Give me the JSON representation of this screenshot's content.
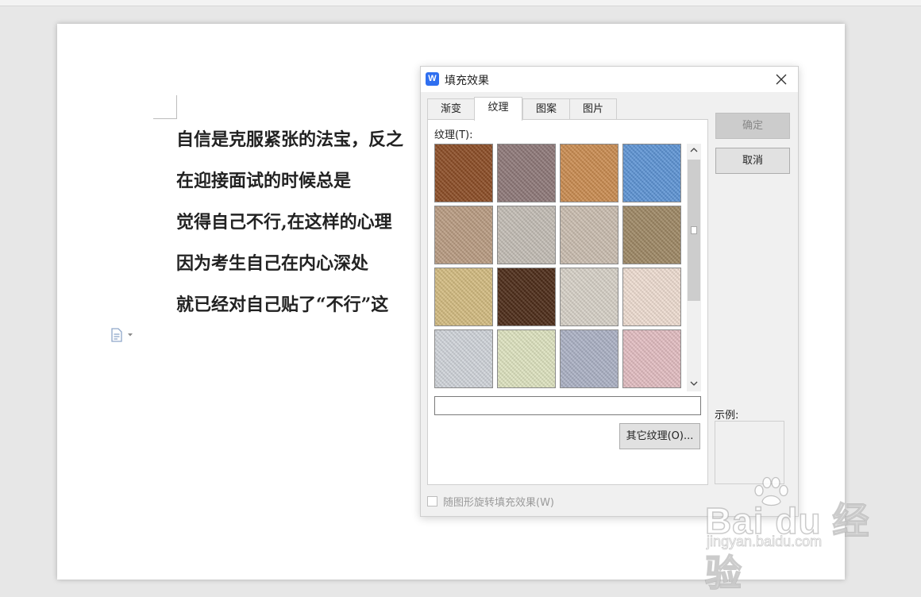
{
  "document": {
    "lines": [
      "自信是克服紧张的法宝，反之",
      "在迎接面试的时候总是",
      "觉得自己不行,在这样的心理",
      "因为考生自己在内心深处",
      "就已经对自己贴了“不行”这"
    ]
  },
  "dialog": {
    "app_icon_letter": "W",
    "title": "填充效果",
    "tabs": [
      "渐变",
      "纹理",
      "图案",
      "图片"
    ],
    "active_tab": "纹理",
    "texture_label": "纹理(T):",
    "texture_name_value": "",
    "other_texture_button": "其它纹理(O)...",
    "ok_button": "确定",
    "cancel_button": "取消",
    "example_label": "示例:",
    "rotate_checkbox_label": "随图形旋转填充效果(W)",
    "rotate_checked": false,
    "textures": [
      {
        "name": "brown-leather",
        "color": "#8a4a22"
      },
      {
        "name": "woven-mat",
        "color": "#8c7676"
      },
      {
        "name": "burlap",
        "color": "#c98a4e"
      },
      {
        "name": "blue-tissue",
        "color": "#5b93d4"
      },
      {
        "name": "granite",
        "color": "#b89a80"
      },
      {
        "name": "white-marble",
        "color": "#c2bcb4"
      },
      {
        "name": "gray-paper",
        "color": "#c9bcae"
      },
      {
        "name": "sand",
        "color": "#9c8662"
      },
      {
        "name": "gold-sand",
        "color": "#d2ba7e"
      },
      {
        "name": "leopard",
        "color": "#4a2814"
      },
      {
        "name": "office-scribble",
        "color": "#d6d0c6"
      },
      {
        "name": "pink-stripes",
        "color": "#eedcd0"
      },
      {
        "name": "fabric-stripes",
        "color": "#cfd3d9"
      },
      {
        "name": "green-weave",
        "color": "#dde2be"
      },
      {
        "name": "blue-plaid",
        "color": "#aab0c4"
      },
      {
        "name": "pink-plaid",
        "color": "#e2bcc0"
      }
    ]
  },
  "watermark": {
    "logo_text": "Bai  du 经验",
    "url": "jingyan.baidu.com"
  }
}
